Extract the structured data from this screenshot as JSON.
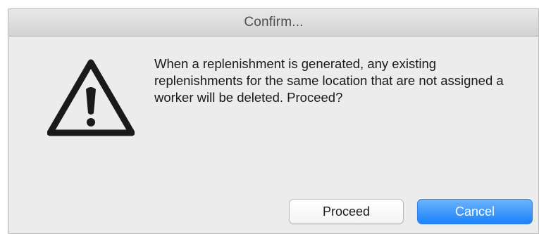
{
  "dialog": {
    "title": "Confirm...",
    "message": "When a replenishment is generated, any existing replenishments for the same location that are not assigned a worker will be deleted. Proceed?",
    "icon": "warning-triangle-icon",
    "buttons": {
      "proceed_label": "Proceed",
      "cancel_label": "Cancel"
    }
  },
  "colors": {
    "dialog_background": "#ececec",
    "titlebar": "#d8d8d8",
    "primary_button": "#1a82fb",
    "icon": "#1a1a1a"
  }
}
